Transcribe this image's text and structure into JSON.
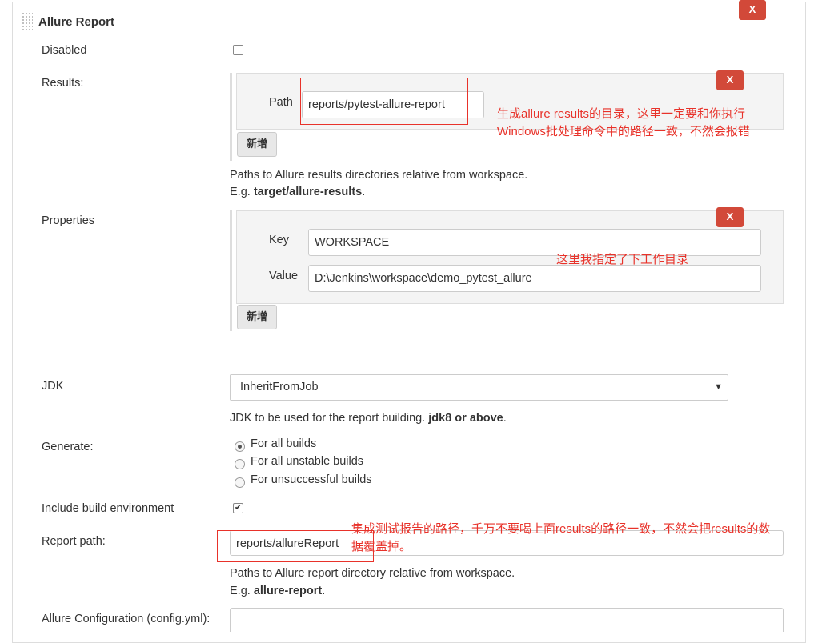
{
  "section_title": "Allure Report",
  "delete_label": "X",
  "add_label": "新增",
  "disabled": {
    "label": "Disabled",
    "checked": false
  },
  "results": {
    "label": "Results:",
    "path_label": "Path",
    "path_value": "reports/pytest-allure-report",
    "help_line1": "Paths to Allure results directories relative from workspace.",
    "help_eg_prefix": "E.g. ",
    "help_eg_bold": "target/allure-results",
    "help_eg_suffix": "."
  },
  "properties": {
    "label": "Properties",
    "key_label": "Key",
    "key_value": "WORKSPACE",
    "value_label": "Value",
    "value_value": "D:\\Jenkins\\workspace\\demo_pytest_allure"
  },
  "jdk": {
    "label": "JDK",
    "selected": "InheritFromJob",
    "help_prefix": "JDK to be used for the report building. ",
    "help_bold": "jdk8 or above",
    "help_suffix": "."
  },
  "generate": {
    "label": "Generate:",
    "options": [
      "For all builds",
      "For all unstable builds",
      "For unsuccessful builds"
    ],
    "selected_index": 0
  },
  "include_env": {
    "label": "Include build environment",
    "checked": true
  },
  "report_path": {
    "label": "Report path:",
    "value": "reports/allureReport",
    "help_line1": "Paths to Allure report directory relative from workspace.",
    "help_eg_prefix": "E.g. ",
    "help_eg_bold": "allure-report",
    "help_eg_suffix": "."
  },
  "config": {
    "label": "Allure Configuration (config.yml):",
    "value": ""
  },
  "annotations": {
    "results_line1": "生成allure results的目录，这里一定要和你执行",
    "results_line2": "Windows批处理命令中的路径一致，不然会报错",
    "workspace": "这里我指定了下工作目录",
    "report_line1": "集成测试报告的路径，千万不要喝上面results的路径一致，不然会把results的数",
    "report_line2": "据覆盖掉。"
  },
  "colors": {
    "delete_button": "#d24939",
    "annotation": "#e8322a"
  }
}
